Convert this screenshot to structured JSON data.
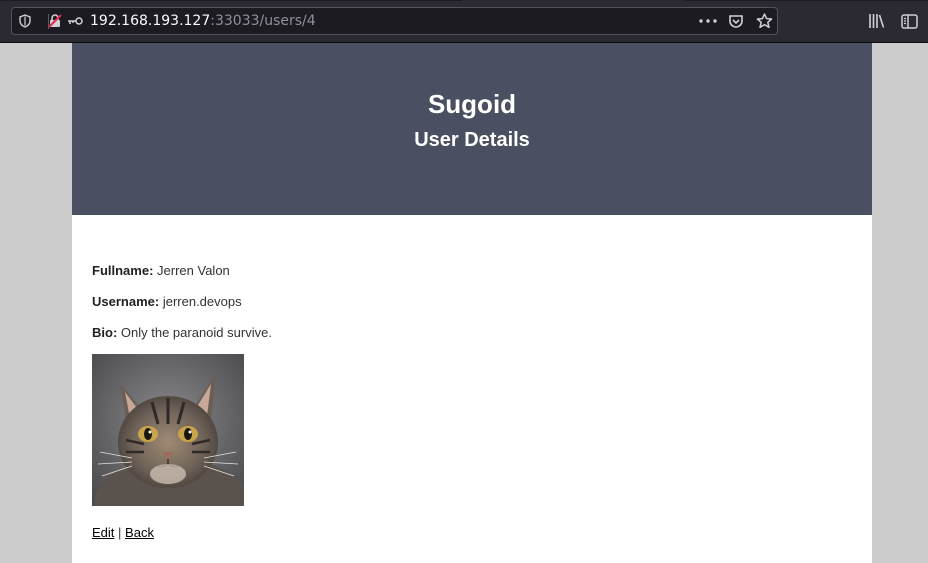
{
  "browser": {
    "url_host": "192.168.193.127",
    "url_rest": ":33033/users/4",
    "icons": [
      "shield-icon",
      "insecure-connection-icon",
      "key-icon",
      "more-actions-icon",
      "pocket-icon",
      "bookmark-star-icon",
      "library-icon",
      "sidebar-icon"
    ]
  },
  "header": {
    "title": "Sugoid",
    "subtitle": "User Details",
    "background_color": "#4a5061"
  },
  "details": {
    "fullname_label": "Fullname:",
    "fullname_value": "Jerren Valon",
    "username_label": "Username:",
    "username_value": "jerren.devops",
    "bio_label": "Bio:",
    "bio_value": "Only the paranoid survive."
  },
  "avatar": {
    "image_alt": "cat photo"
  },
  "actions": {
    "edit_label": "Edit",
    "separator": "|",
    "back_label": "Back"
  }
}
